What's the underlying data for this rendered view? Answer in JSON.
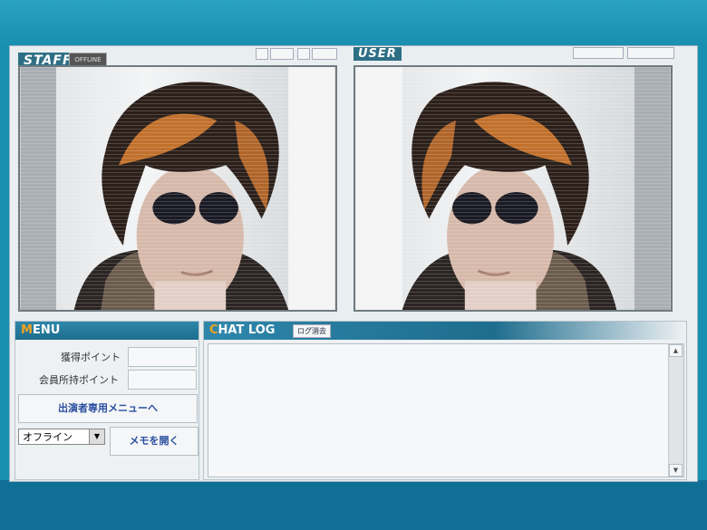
{
  "header": {
    "staff_label": "STAFF",
    "status_badge": "OFFLINE",
    "user_label": "USER"
  },
  "video": {
    "left_name": "staff-video",
    "right_name": "user-video"
  },
  "menu": {
    "title_first": "M",
    "title_rest": "ENU",
    "earned_points_label": "獲得ポイント",
    "member_points_label": "会員所持ポイント",
    "performer_menu_button": "出演者専用メニューへ",
    "status_select_value": "オフライン",
    "open_memo_button": "メモを開く"
  },
  "chat": {
    "title_first": "C",
    "title_rest": "HAT LOG",
    "clear_log_button": "ログ消去"
  },
  "colors": {
    "accent": "#1e6d8e",
    "title_initial": "#f2a21f",
    "background": "#1a8fb0"
  },
  "icons": {
    "scroll_up": "▲",
    "scroll_down": "▼",
    "dropdown": "▼"
  }
}
